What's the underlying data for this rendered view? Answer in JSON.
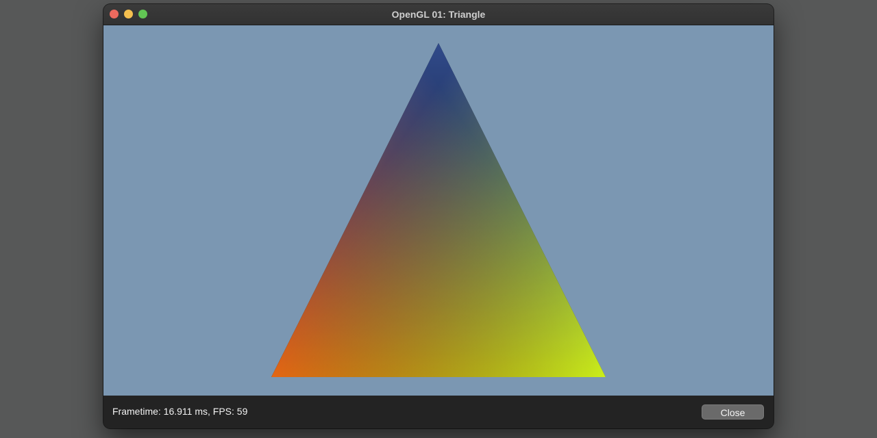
{
  "window": {
    "title": "OpenGL 01: Triangle",
    "controls": {
      "close_color": "#ed6a5e",
      "minimize_color": "#f5c04f",
      "zoom_color": "#62c554"
    }
  },
  "viewport": {
    "clear_color": "#7b97b2",
    "triangle": {
      "top_color": "#304a8a",
      "bottom_left_color": "#e35a10",
      "bottom_right_color": "#c8ee18"
    }
  },
  "status": {
    "stats_text": "Frametime: 16.911 ms, FPS: 59",
    "close_label": "Close"
  }
}
